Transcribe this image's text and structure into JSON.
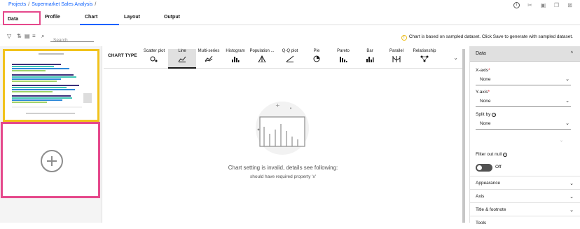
{
  "breadcrumb": {
    "projects": "Projects",
    "sep1": "/",
    "asset": "Supermarket Sales Analysis",
    "sep2": "/"
  },
  "header_icons": [
    "info-icon",
    "scissors-icon",
    "save-icon",
    "copy-icon",
    "close-icon"
  ],
  "tabs": {
    "data": "Data",
    "profile": "Profile",
    "chart": "Chart",
    "layout": "Layout",
    "output": "Output",
    "selected": "Chart"
  },
  "toolbar": {
    "search_placeholder": "Search"
  },
  "notice": "Chart is based on sampled dataset. Click Save to generate with sampled dataset.",
  "chart_type_bar": {
    "label": "CHART TYPE",
    "types": [
      "Scatter plot",
      "Line",
      "Multi-series",
      "Histogram",
      "Population ...",
      "Q-Q plot",
      "Pie",
      "Pareto",
      "Bar",
      "Parallel",
      "Relationship"
    ],
    "selected": "Line"
  },
  "canvas": {
    "message": "Chart setting is invalid, details see following:",
    "detail": "should have required property 'x'"
  },
  "panel": {
    "section": "Data",
    "x_axis_label": "X-axis",
    "x_axis_value": "None",
    "y_axis_label": "Y-axis",
    "y_axis_value": "None",
    "split_by_label": "Split by",
    "split_by_value": "None",
    "filter_label": "Filter out null",
    "toggle_state": "Off",
    "sections": [
      "Appearance",
      "Axis",
      "Title & footnote",
      "Tools"
    ]
  },
  "colors": {
    "accent": "#0f62fe",
    "highlight": "#e5488b",
    "thumb_border": "#f1c21b",
    "required": "#da1e28"
  }
}
